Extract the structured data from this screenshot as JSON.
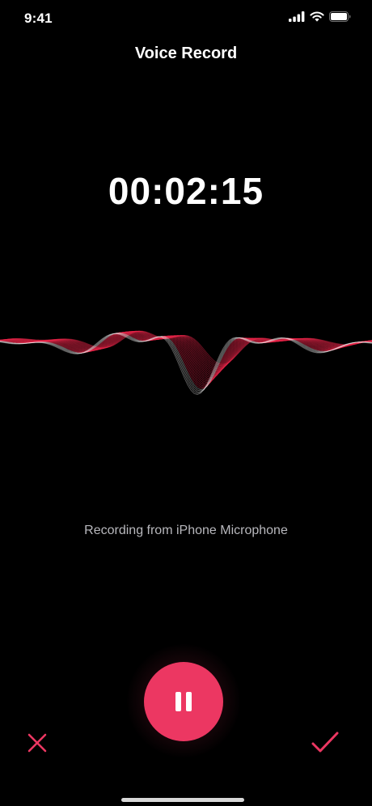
{
  "status_bar": {
    "time": "9:41",
    "icons": [
      "cellular-signal-icon",
      "wifi-icon",
      "battery-icon"
    ]
  },
  "header": {
    "title": "Voice Record"
  },
  "recorder": {
    "elapsed": "00:02:15",
    "source_label": "Recording from iPhone Microphone",
    "state": "recording"
  },
  "controls": {
    "cancel_icon": "close-icon",
    "pause_icon": "pause-icon",
    "confirm_icon": "checkmark-icon"
  },
  "colors": {
    "accent": "#ec3762",
    "wave_primary": "#e8264a",
    "wave_secondary": "#ffffff",
    "background": "#000000"
  }
}
